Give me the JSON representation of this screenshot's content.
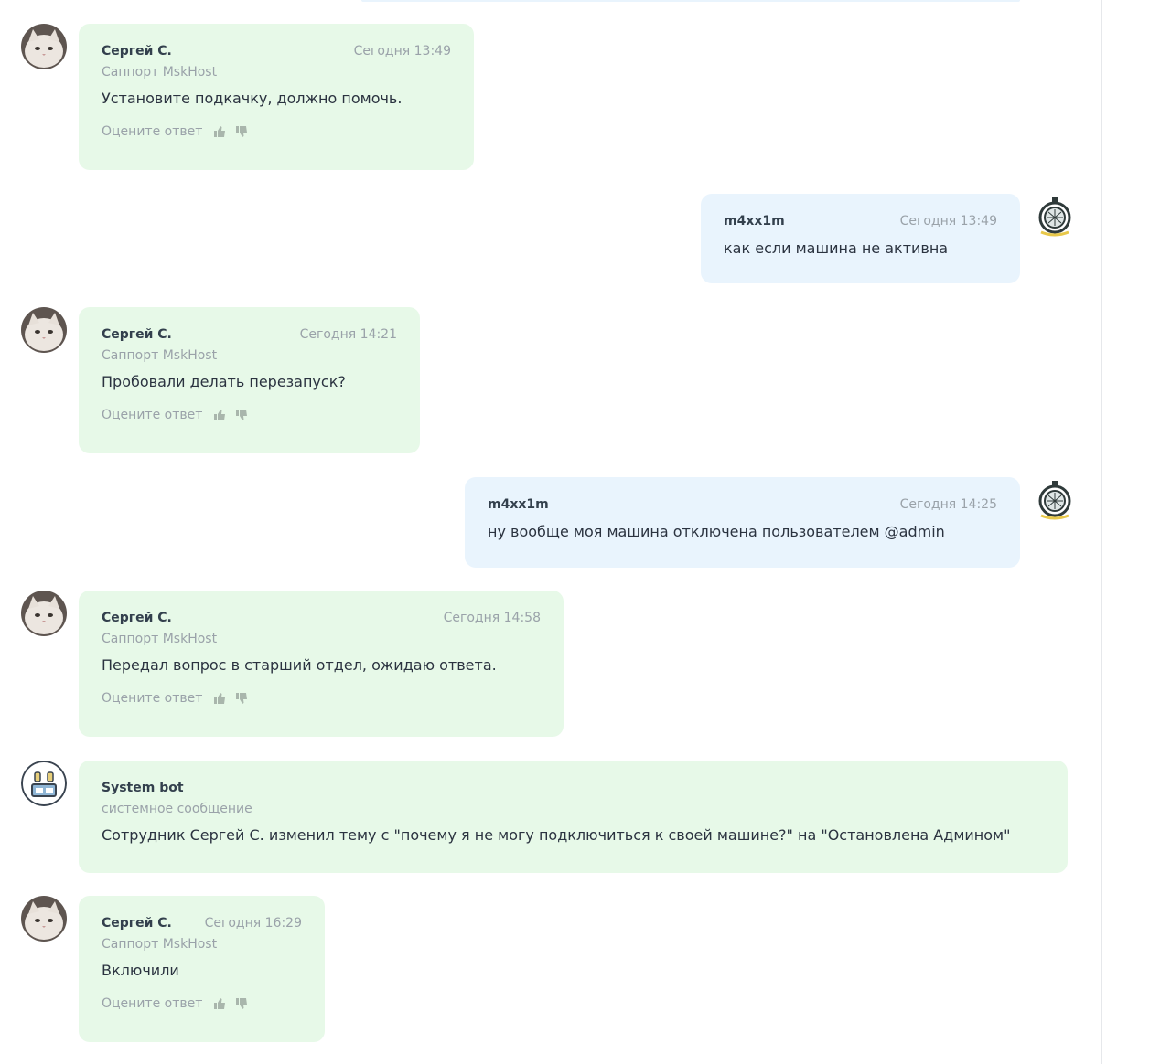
{
  "theme": {
    "staff_bubble": "#e7f9e8",
    "user_bubble": "#e9f4fd",
    "muted_text": "#9aa2a9",
    "main_text": "#2b3340"
  },
  "messages": [
    {
      "kind": "staff",
      "author": "Сергей С.",
      "role": "Саппорт MskHost",
      "time": "Сегодня 13:49",
      "text": "Установите подкачку, должно помочь.",
      "rate_label": "Оцените ответ",
      "icons": [
        "cat-avatar",
        "thumbs-up-icon",
        "thumbs-down-icon"
      ]
    },
    {
      "kind": "user",
      "author": "m4xx1m",
      "time": "Сегодня 13:49",
      "text": "как если машина не активна",
      "icons": [
        "astronaut-avatar"
      ]
    },
    {
      "kind": "staff",
      "author": "Сергей С.",
      "role": "Саппорт MskHost",
      "time": "Сегодня 14:21",
      "text": "Пробовали делать перезапуск?",
      "rate_label": "Оцените ответ",
      "icons": [
        "cat-avatar",
        "thumbs-up-icon",
        "thumbs-down-icon"
      ]
    },
    {
      "kind": "user",
      "author": "m4xx1m",
      "time": "Сегодня 14:25",
      "text": "ну вообще моя машина отключена пользователем @admin",
      "icons": [
        "astronaut-avatar"
      ]
    },
    {
      "kind": "staff",
      "author": "Сергей С.",
      "role": "Саппорт MskHost",
      "time": "Сегодня 14:58",
      "text": "Передал вопрос в старший отдел, ожидаю ответа.",
      "rate_label": "Оцените ответ",
      "icons": [
        "cat-avatar",
        "thumbs-up-icon",
        "thumbs-down-icon"
      ]
    },
    {
      "kind": "bot",
      "author": "System bot",
      "role": "системное сообщение",
      "text": "Сотрудник Сергей С. изменил тему с \"почему я не могу подключиться к своей машине?\" на \"Остановлена Админом\"",
      "icons": [
        "robot-avatar"
      ]
    },
    {
      "kind": "staff",
      "author": "Сергей С.",
      "role": "Саппорт MskHost",
      "time": "Сегодня 16:29",
      "text": "Включили",
      "rate_label": "Оцените ответ",
      "icons": [
        "cat-avatar",
        "thumbs-up-icon",
        "thumbs-down-icon"
      ]
    }
  ]
}
